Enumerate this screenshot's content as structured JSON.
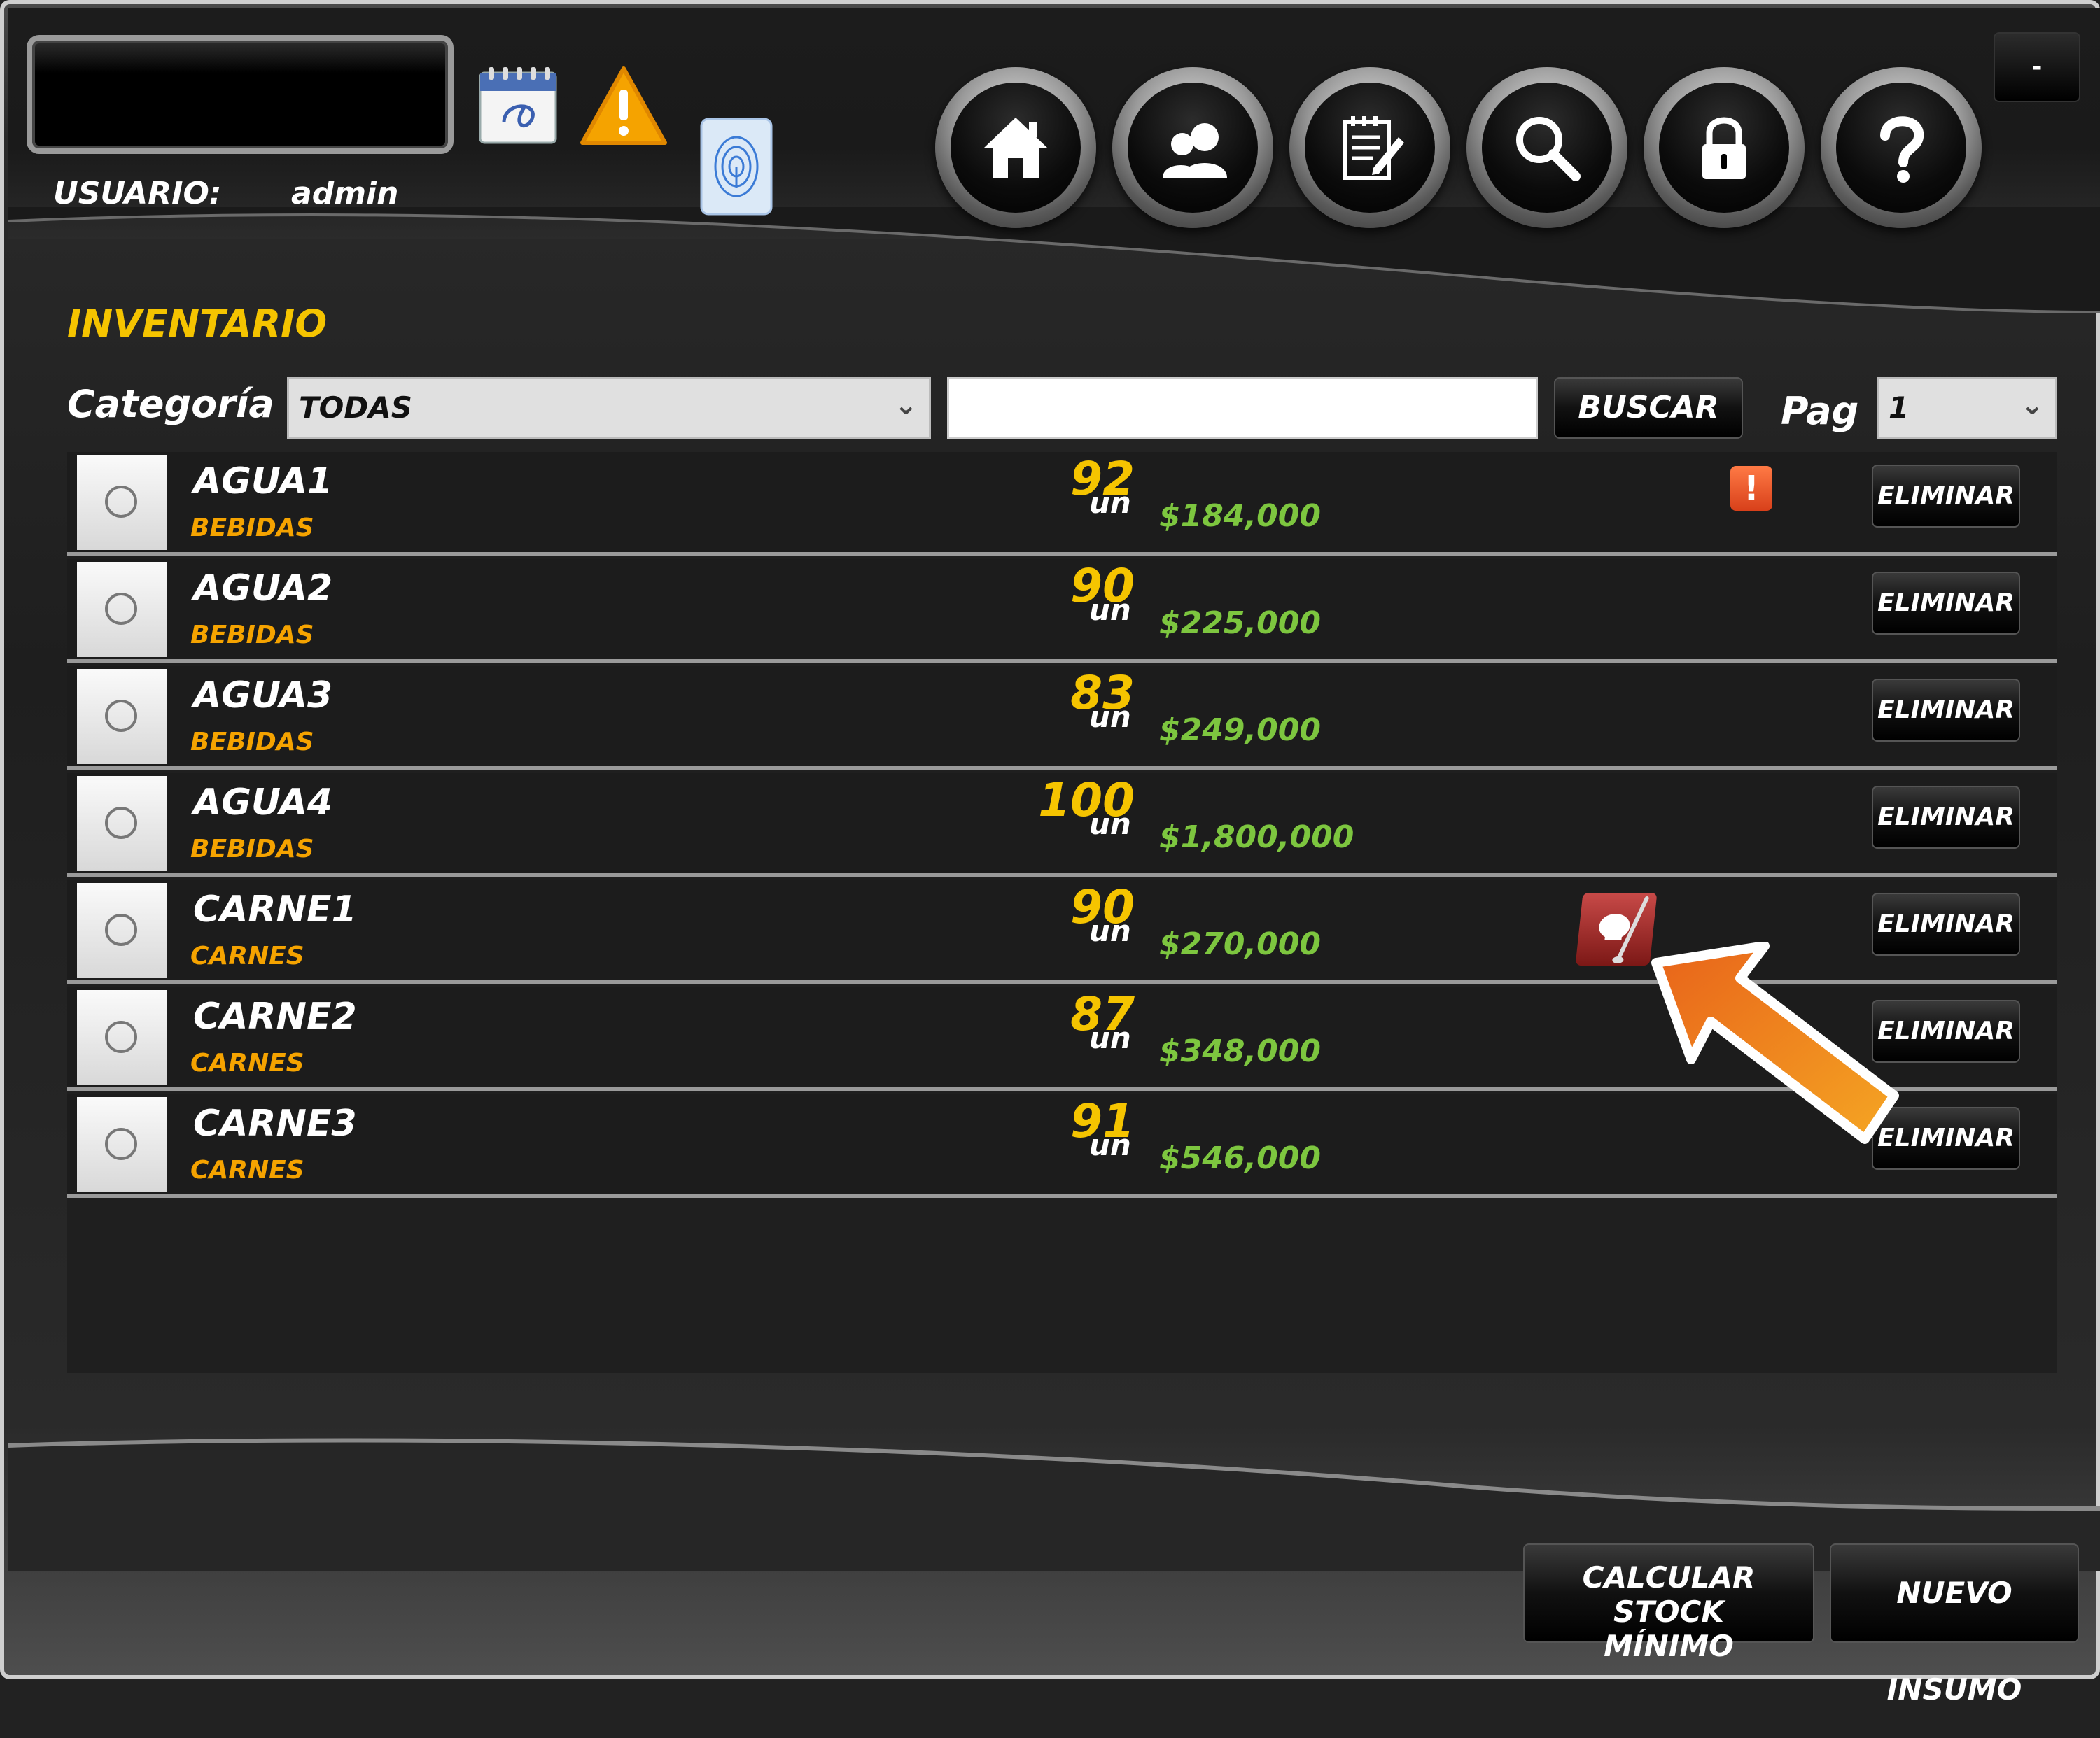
{
  "header": {
    "user_label": "USUARIO:",
    "user_name": "admin",
    "minimize_label": "-",
    "nav": [
      {
        "name": "home-icon"
      },
      {
        "name": "users-icon"
      },
      {
        "name": "notes-icon"
      },
      {
        "name": "search-icon"
      },
      {
        "name": "lock-icon"
      },
      {
        "name": "help-icon"
      }
    ]
  },
  "main": {
    "title": "INVENTARIO",
    "category_label": "Categoría",
    "category_value": "TODAS",
    "search_value": "",
    "search_button": "BUSCAR",
    "page_label": "Pag",
    "page_value": "1"
  },
  "items": [
    {
      "name": "AGUA1",
      "category": "BEBIDAS",
      "qty": "92",
      "unit": "un",
      "price": "$184,000",
      "delete": "ELIMINAR",
      "alert": "!"
    },
    {
      "name": "AGUA2",
      "category": "BEBIDAS",
      "qty": "90",
      "unit": "un",
      "price": "$225,000",
      "delete": "ELIMINAR"
    },
    {
      "name": "AGUA3",
      "category": "BEBIDAS",
      "qty": "83",
      "unit": "un",
      "price": "$249,000",
      "delete": "ELIMINAR"
    },
    {
      "name": "AGUA4",
      "category": "BEBIDAS",
      "qty": "100",
      "unit": "un",
      "price": "$1,800,000",
      "delete": "ELIMINAR"
    },
    {
      "name": "CARNE1",
      "category": "CARNES",
      "qty": "90",
      "unit": "un",
      "price": "$270,000",
      "delete": "ELIMINAR"
    },
    {
      "name": "CARNE2",
      "category": "CARNES",
      "qty": "87",
      "unit": "un",
      "price": "$348,000",
      "delete": "ELIMINAR"
    },
    {
      "name": "CARNE3",
      "category": "CARNES",
      "qty": "91",
      "unit": "un",
      "price": "$546,000",
      "delete": "ELIMINAR"
    }
  ],
  "footer": {
    "calc_line1": "CALCULAR STOCK",
    "calc_line2": "MÍNIMO",
    "new_button": "NUEVO INSUMO"
  },
  "colors": {
    "title_yellow": "#f5c400",
    "category_orange": "#f5a300",
    "price_green": "#7dc63f",
    "alert_orange": "#e8542a",
    "arrow_orange": "#f08a1c"
  }
}
